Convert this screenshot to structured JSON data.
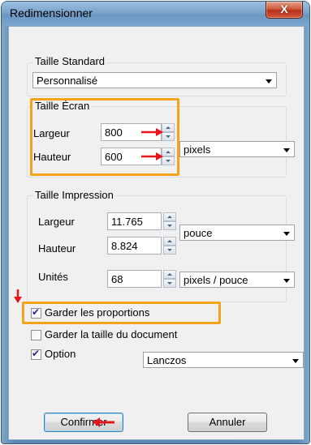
{
  "window": {
    "title": "Redimensionner",
    "close_glyph": "X"
  },
  "standard": {
    "label": "Taille Standard",
    "selected": "Personnalisé"
  },
  "ecran": {
    "label": "Taille Écran",
    "largeur_label": "Largeur",
    "largeur_value": "800",
    "hauteur_label": "Hauteur",
    "hauteur_value": "600",
    "unit": "pixels"
  },
  "impression": {
    "label": "Taille Impression",
    "largeur_label": "Largeur",
    "largeur_value": "11.765",
    "hauteur_label": "Hauteur",
    "hauteur_value": "8.824",
    "unit": "pouce",
    "unites_label": "Unités",
    "unites_value": "68",
    "resolution_unit": "pixels / pouce"
  },
  "options": {
    "keep_proportions": {
      "label": "Garder les proportions",
      "checked": true
    },
    "keep_doc_size": {
      "label": "Garder la taille du document",
      "checked": false
    },
    "option": {
      "label": "Option",
      "checked": true
    },
    "resample": "Lanczos"
  },
  "buttons": {
    "confirm": "Confirmer",
    "cancel": "Annuler"
  },
  "colors": {
    "highlight": "#f5a31a",
    "annotation_arrow": "#e8141c"
  }
}
